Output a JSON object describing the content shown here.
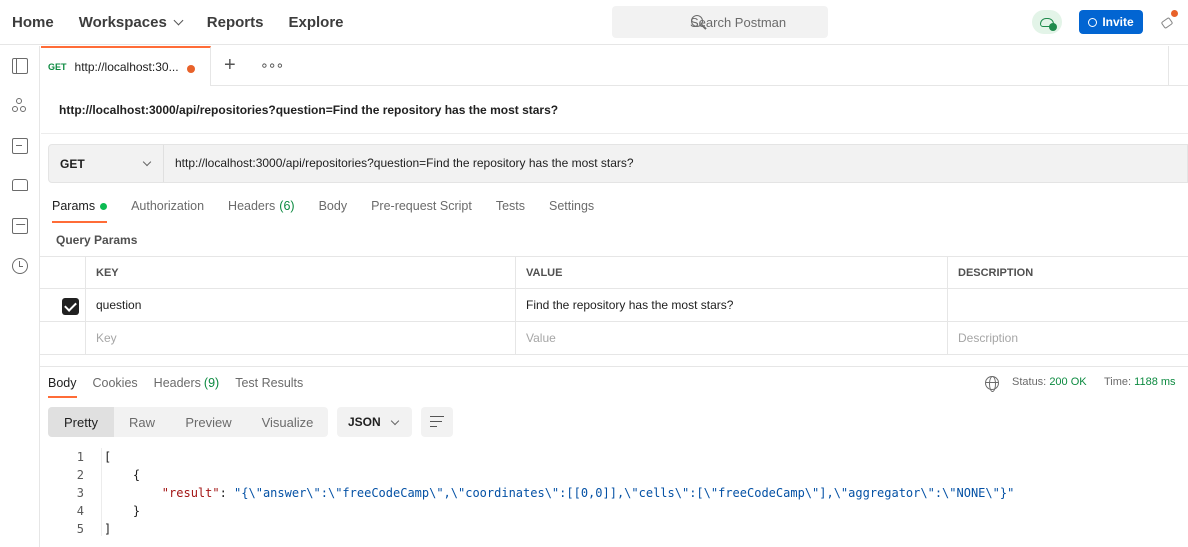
{
  "nav": {
    "home": "Home",
    "workspaces": "Workspaces",
    "reports": "Reports",
    "explore": "Explore"
  },
  "search": {
    "placeholder": "Search Postman"
  },
  "invite": {
    "label": "Invite"
  },
  "request_tab": {
    "method": "GET",
    "name": "http://localhost:30..."
  },
  "title_url": "http://localhost:3000/api/repositories?question=Find the repository has the most stars?",
  "url_bar": {
    "method": "GET",
    "url": "http://localhost:3000/api/repositories?question=Find the repository has the most stars?"
  },
  "request_tabs": {
    "params": "Params",
    "authorization": "Authorization",
    "headers": "Headers",
    "headers_count": "(6)",
    "body": "Body",
    "prerequest": "Pre-request Script",
    "tests": "Tests",
    "settings": "Settings"
  },
  "query_params": {
    "label": "Query Params",
    "columns": {
      "key": "KEY",
      "value": "VALUE",
      "description": "DESCRIPTION"
    },
    "rows": [
      {
        "key": "question",
        "value": "Find the repository has the most stars?",
        "description": "",
        "checked": true
      }
    ],
    "placeholders": {
      "key": "Key",
      "value": "Value",
      "description": "Description"
    }
  },
  "response_tabs": {
    "body": "Body",
    "cookies": "Cookies",
    "headers": "Headers",
    "headers_count": "(9)",
    "test_results": "Test Results"
  },
  "status": {
    "label": "Status:",
    "value": "200 OK"
  },
  "time": {
    "label": "Time:",
    "value": "1188 ms"
  },
  "view_modes": {
    "pretty": "Pretty",
    "raw": "Raw",
    "preview": "Preview",
    "visualize": "Visualize"
  },
  "format": "JSON",
  "code": {
    "line_numbers": [
      "1",
      "2",
      "3",
      "4",
      "5"
    ],
    "l1": "[",
    "l2": "    {",
    "l3_key": "\"result\"",
    "l3_colon": ": ",
    "l3_value": "\"{\\\"answer\\\":\\\"freeCodeCamp\\\",\\\"coordinates\\\":[[0,0]],\\\"cells\\\":[\\\"freeCodeCamp\\\"],\\\"aggregator\\\":\\\"NONE\\\"}\"",
    "l4": "    }",
    "l5": "]"
  },
  "colors": {
    "accent": "#ff6c37",
    "invite": "#0265d2",
    "success": "#0c8a40"
  }
}
